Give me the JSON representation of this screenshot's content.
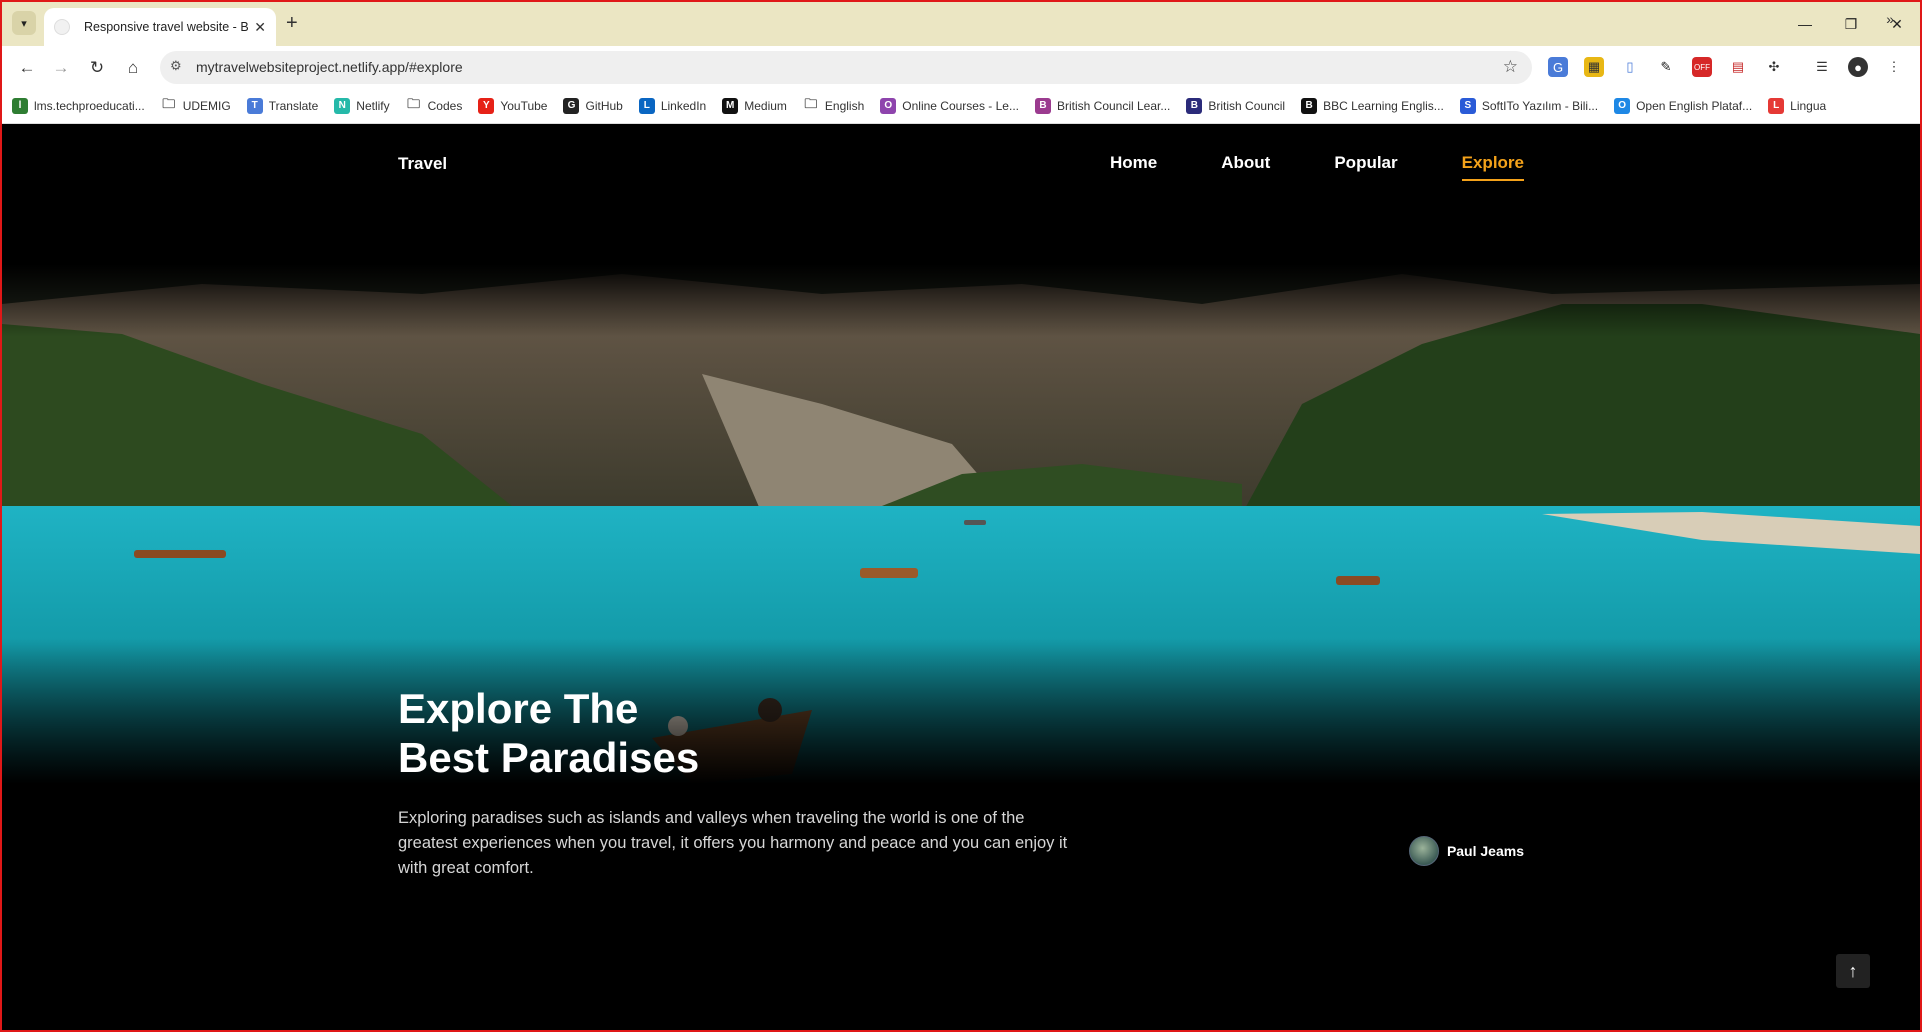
{
  "browser": {
    "tab_title": "Responsive travel website - Bec",
    "url": "mytravelwebsiteproject.netlify.app/#explore",
    "bookmarks": [
      {
        "label": "lms.techproeducati...",
        "icon": "check-icon",
        "color": "#2e7d32"
      },
      {
        "label": "UDEMIG",
        "icon": "folder-icon",
        "color": "#555555"
      },
      {
        "label": "Translate",
        "icon": "translate-icon",
        "color": "#4a7bd8"
      },
      {
        "label": "Netlify",
        "icon": "netlify-icon",
        "color": "#25b9a9"
      },
      {
        "label": "Codes",
        "icon": "folder-icon",
        "color": "#555555"
      },
      {
        "label": "YouTube",
        "icon": "youtube-icon",
        "color": "#e62117"
      },
      {
        "label": "GitHub",
        "icon": "github-icon",
        "color": "#222222"
      },
      {
        "label": "LinkedIn",
        "icon": "linkedin-icon",
        "color": "#0a66c2"
      },
      {
        "label": "Medium",
        "icon": "medium-icon",
        "color": "#111111"
      },
      {
        "label": "English",
        "icon": "folder-icon",
        "color": "#555555"
      },
      {
        "label": "Online Courses - Le...",
        "icon": "course-icon",
        "color": "#8e44ad"
      },
      {
        "label": "British Council Lear...",
        "icon": "british-council-icon",
        "color": "#9b3b8f"
      },
      {
        "label": "British Council",
        "icon": "british-council-icon",
        "color": "#2b2b7a"
      },
      {
        "label": "BBC Learning Englis...",
        "icon": "bbc-icon",
        "color": "#111111"
      },
      {
        "label": "SoftITo Yazılım - Bili...",
        "icon": "softito-icon",
        "color": "#2a5bd7"
      },
      {
        "label": "Open English Plataf...",
        "icon": "open-english-icon",
        "color": "#1e88e5"
      },
      {
        "label": "Lingua",
        "icon": "lingua-icon",
        "color": "#e53935"
      }
    ]
  },
  "site": {
    "logo": "Travel",
    "nav": [
      {
        "label": "Home"
      },
      {
        "label": "About"
      },
      {
        "label": "Popular"
      },
      {
        "label": "Explore",
        "active": true
      }
    ],
    "headline_line1": "Explore The",
    "headline_line2": "Best Paradises",
    "description": "Exploring paradises such as islands and valleys when traveling the world is one of the greatest experiences when you travel, it offers you harmony and peace and you can enjoy it with great comfort.",
    "author": "Paul Jeams",
    "accent_color": "#f4a21a",
    "scrollup_icon": "arrow-up-icon"
  }
}
